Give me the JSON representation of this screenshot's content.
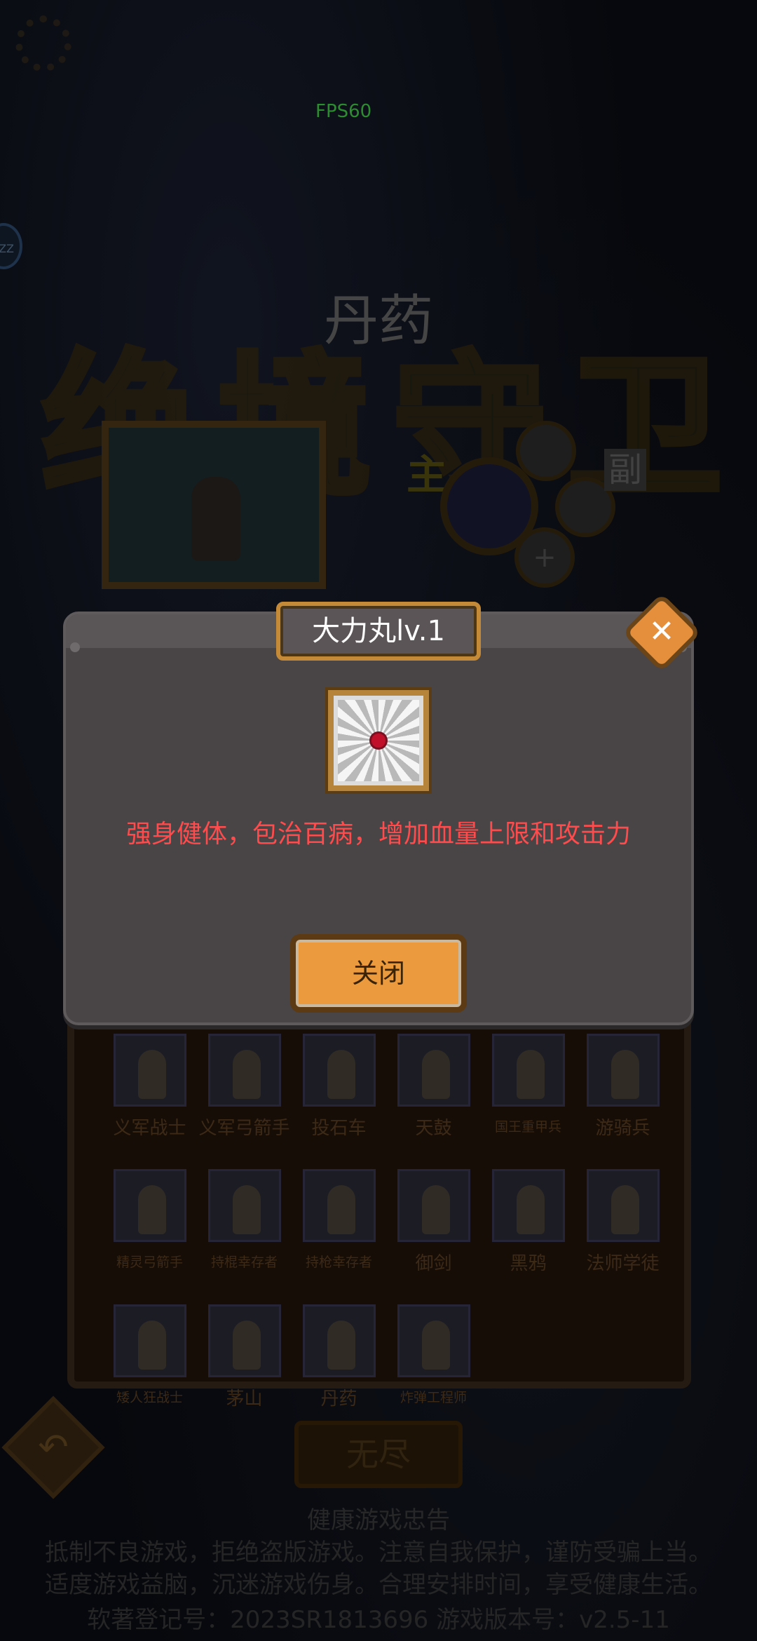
{
  "hud": {
    "fps": "FPS60",
    "zz": "ZZ"
  },
  "hero": {
    "title": "丹药",
    "banner_chars": [
      "绝",
      "境",
      "守",
      "卫"
    ]
  },
  "skills": {
    "main_label": "主",
    "sub_label": "副",
    "add_symbol": "+"
  },
  "modal": {
    "title": "大力丸lv.1",
    "close_symbol": "✕",
    "description": "强身健体，包治百病，增加血量上限和攻击力",
    "close_button": "关闭"
  },
  "roster": {
    "units": [
      {
        "label": "义军战士",
        "small": false
      },
      {
        "label": "义军弓箭手",
        "small": false
      },
      {
        "label": "投石车",
        "small": false
      },
      {
        "label": "天鼓",
        "small": false
      },
      {
        "label": "国王重甲兵",
        "small": true
      },
      {
        "label": "游骑兵",
        "small": false
      },
      {
        "label": "精灵弓箭手",
        "small": true
      },
      {
        "label": "持棍幸存者",
        "small": true
      },
      {
        "label": "持枪幸存者",
        "small": true
      },
      {
        "label": "御剑",
        "small": false
      },
      {
        "label": "黑鸦",
        "small": false
      },
      {
        "label": "法师学徒",
        "small": false
      },
      {
        "label": "矮人狂战士",
        "small": true
      },
      {
        "label": "茅山",
        "small": false
      },
      {
        "label": "丹药",
        "small": false
      },
      {
        "label": "炸弹工程师",
        "small": true
      }
    ]
  },
  "bottom": {
    "back_symbol": "↶",
    "endless_button": "无尽",
    "notice_title": "健康游戏忠告",
    "notice_line1": "抵制不良游戏，拒绝盗版游戏。注意自我保护，谨防受骗上当。",
    "notice_line2": "适度游戏益脑，沉迷游戏伤身。合理安排时间，享受健康生活。",
    "registration": "软著登记号：2023SR1813696    游戏版本号：v2.5-11"
  }
}
